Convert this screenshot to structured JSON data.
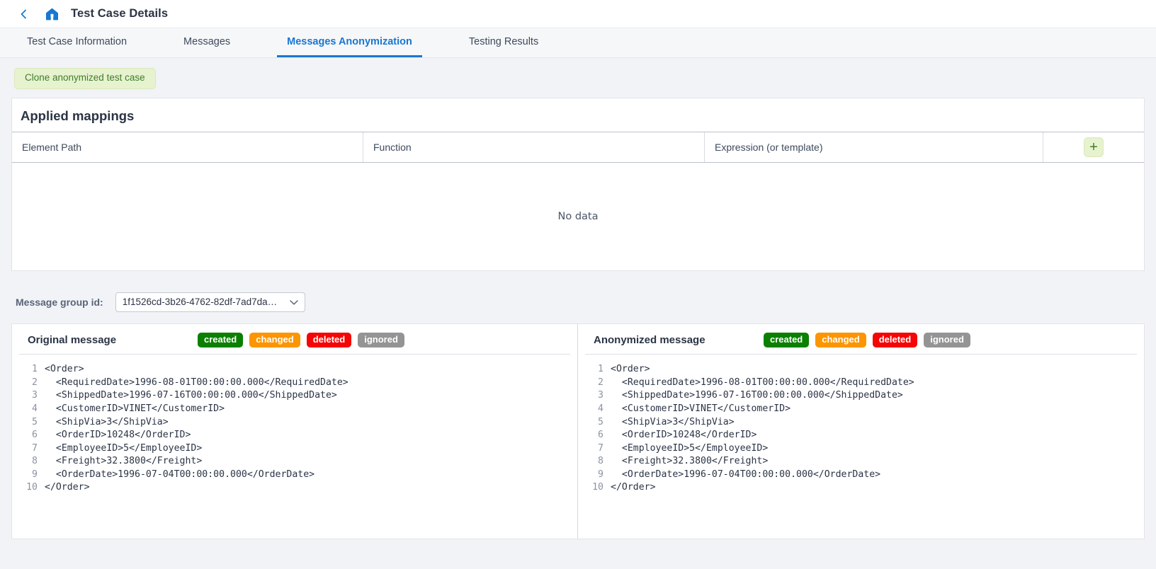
{
  "header": {
    "back_icon": "chevron-left-icon",
    "home_icon": "home-icon",
    "title": "Test Case Details"
  },
  "tabs": [
    {
      "label": "Test Case Information",
      "active": false
    },
    {
      "label": "Messages",
      "active": false
    },
    {
      "label": "Messages Anonymization",
      "active": true
    },
    {
      "label": "Testing Results",
      "active": false
    }
  ],
  "actions": {
    "clone_button": "Clone anonymized test case"
  },
  "applied_mappings": {
    "title": "Applied mappings",
    "columns": [
      "Element Path",
      "Function",
      "Expression (or template)"
    ],
    "add_button": "+",
    "empty_text": "No data"
  },
  "message_group": {
    "label": "Message group id:",
    "selected_value": "1f1526cd-3b26-4762-82df-7ad7da…",
    "caret_icon": "chevron-down-icon"
  },
  "legend_badges": [
    {
      "label": "created",
      "color": "#0b8000"
    },
    {
      "label": "changed",
      "color": "#fb9500"
    },
    {
      "label": "deleted",
      "color": "#f50505"
    },
    {
      "label": "ignored",
      "color": "#949494"
    }
  ],
  "panels": {
    "original": {
      "title": "Original message",
      "lines": [
        "<Order>",
        "  <RequiredDate>1996-08-01T00:00:00.000</RequiredDate>",
        "  <ShippedDate>1996-07-16T00:00:00.000</ShippedDate>",
        "  <CustomerID>VINET</CustomerID>",
        "  <ShipVia>3</ShipVia>",
        "  <OrderID>10248</OrderID>",
        "  <EmployeeID>5</EmployeeID>",
        "  <Freight>32.3800</Freight>",
        "  <OrderDate>1996-07-04T00:00:00.000</OrderDate>",
        "</Order>"
      ]
    },
    "anonymized": {
      "title": "Anonymized message",
      "lines": [
        "<Order>",
        "  <RequiredDate>1996-08-01T00:00:00.000</RequiredDate>",
        "  <ShippedDate>1996-07-16T00:00:00.000</ShippedDate>",
        "  <CustomerID>VINET</CustomerID>",
        "  <ShipVia>3</ShipVia>",
        "  <OrderID>10248</OrderID>",
        "  <EmployeeID>5</EmployeeID>",
        "  <Freight>32.3800</Freight>",
        "  <OrderDate>1996-07-04T00:00:00.000</OrderDate>",
        "</Order>"
      ]
    }
  },
  "colors": {
    "accent": "#1877d2",
    "green_soft_bg": "#e7f2cf",
    "green_text": "#3f7d2d"
  }
}
